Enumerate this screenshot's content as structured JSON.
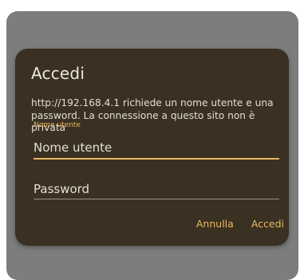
{
  "dialog": {
    "title": "Accedi",
    "message": "http://192.168.4.1 richiede un nome utente e una password. La connessione a questo sito non è privata",
    "username": {
      "floating_label": "Nome utente",
      "placeholder": "Nome utente",
      "value": ""
    },
    "password": {
      "placeholder": "Password",
      "value": ""
    },
    "buttons": {
      "cancel_label": "Annulla",
      "confirm_label": "Accedi"
    }
  },
  "colors": {
    "scrim": "#7d7d7d",
    "dialog_background": "#3a3122",
    "accent": "#e9b765",
    "text": "#e3ddd3"
  }
}
